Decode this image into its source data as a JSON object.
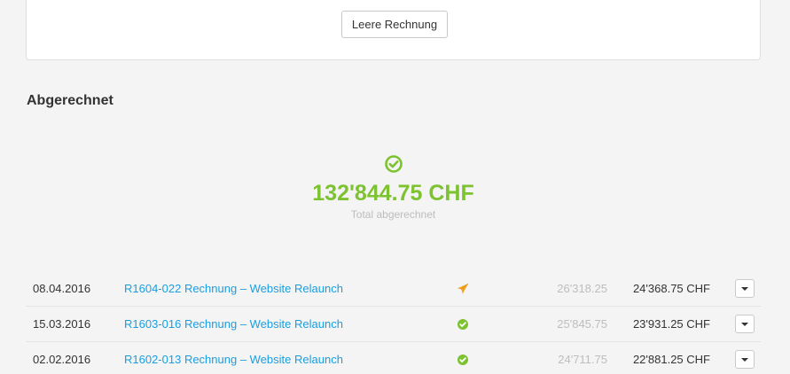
{
  "top_card": {
    "empty_invoice_button": "Leere Rechnung"
  },
  "section": {
    "title": "Abgerechnet"
  },
  "summary": {
    "icon": "check-circle-icon",
    "amount": "132'844.75 CHF",
    "label": "Total abgerechnet"
  },
  "colors": {
    "success": "#7dc230",
    "link": "#1a9ee0",
    "sent": "#f5a623",
    "muted": "#bdbdbd"
  },
  "invoices": [
    {
      "date": "08.04.2016",
      "title": "R1604-022 Rechnung – Website Relaunch",
      "status_icon": "paper-plane-icon",
      "gross": "26'318.25",
      "net": "24'368.75 CHF"
    },
    {
      "date": "15.03.2016",
      "title": "R1603-016 Rechnung – Website Relaunch",
      "status_icon": "check-circle-icon",
      "gross": "25'845.75",
      "net": "23'931.25 CHF"
    },
    {
      "date": "02.02.2016",
      "title": "R1602-013 Rechnung – Website Relaunch",
      "status_icon": "check-circle-icon",
      "gross": "24'711.75",
      "net": "22'881.25 CHF"
    }
  ]
}
